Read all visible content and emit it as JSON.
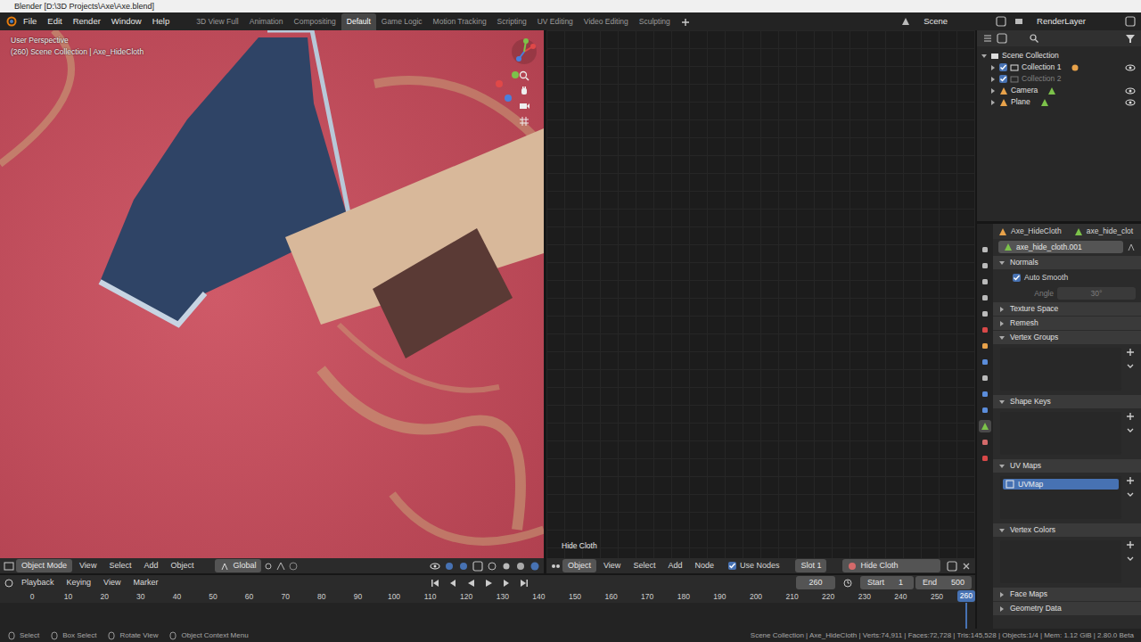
{
  "window": {
    "title": "Blender [D:\\3D Projects\\Axe\\Axe.blend]"
  },
  "menu": [
    "File",
    "Edit",
    "Render",
    "Window",
    "Help"
  ],
  "workspaces": [
    {
      "label": "3D View Full",
      "selected": false
    },
    {
      "label": "Animation",
      "selected": false
    },
    {
      "label": "Compositing",
      "selected": false
    },
    {
      "label": "Default",
      "selected": true
    },
    {
      "label": "Game Logic",
      "selected": false
    },
    {
      "label": "Motion Tracking",
      "selected": false
    },
    {
      "label": "Scripting",
      "selected": false
    },
    {
      "label": "UV Editing",
      "selected": false
    },
    {
      "label": "Video Editing",
      "selected": false
    },
    {
      "label": "Sculpting",
      "selected": false
    }
  ],
  "scene": "Scene",
  "render_layer": "RenderLayer",
  "viewport": {
    "overlay_title": "User Perspective",
    "overlay_info": "(260) Scene Collection | Axe_HideCloth",
    "mode": "Object Mode",
    "menus": [
      "View",
      "Select",
      "Add",
      "Object"
    ],
    "orientation": "Global"
  },
  "node_editor": {
    "node_label": "Hide Cloth",
    "mode": "Object",
    "menus": [
      "View",
      "Select",
      "Add",
      "Node"
    ],
    "use_nodes": {
      "label": "Use Nodes",
      "checked": true
    },
    "slot": "Slot 1",
    "material": "Hide Cloth"
  },
  "timeline": {
    "menus": [
      "Playback",
      "Keying",
      "View",
      "Marker"
    ],
    "current_frame": "260",
    "start_label": "Start",
    "start": "1",
    "end_label": "End",
    "end": "500",
    "ticks": [
      "0",
      "10",
      "20",
      "30",
      "40",
      "50",
      "60",
      "70",
      "80",
      "90",
      "100",
      "110",
      "120",
      "130",
      "140",
      "150",
      "160",
      "170",
      "180",
      "190",
      "200",
      "210",
      "220",
      "230",
      "240",
      "250"
    ],
    "playhead": "260"
  },
  "outliner": {
    "items": [
      {
        "label": "Scene Collection",
        "kind": "scene",
        "expanded": true,
        "disabled": false,
        "visible": false
      },
      {
        "label": "Collection 1",
        "kind": "collection",
        "expanded": false,
        "checked": true,
        "disabled": false,
        "visible": true
      },
      {
        "label": "Collection 2",
        "kind": "collection",
        "expanded": false,
        "checked": true,
        "disabled": true,
        "visible": false
      },
      {
        "label": "Camera",
        "kind": "object",
        "expanded": false,
        "disabled": false,
        "visible": true
      },
      {
        "label": "Plane",
        "kind": "object",
        "expanded": false,
        "disabled": false,
        "visible": true
      }
    ]
  },
  "property_tabs": [
    {
      "selected": false
    },
    {
      "selected": false
    },
    {
      "selected": false
    },
    {
      "selected": false
    },
    {
      "selected": false
    },
    {
      "selected": false
    },
    {
      "selected": false
    },
    {
      "selected": false
    },
    {
      "selected": false
    },
    {
      "selected": false
    },
    {
      "selected": false
    },
    {
      "selected": true
    },
    {
      "selected": false
    },
    {
      "selected": false
    }
  ],
  "properties": {
    "object": "Axe_HideCloth",
    "mesh_tab": "axe_hide_clot",
    "datablock": "axe_hide_cloth.001",
    "panels": [
      {
        "title": "Normals",
        "kind": "normals",
        "expanded": true,
        "auto_smooth": {
          "label": "Auto Smooth",
          "checked": true
        },
        "angle": {
          "label": "Angle",
          "value": "30°",
          "disabled": true
        }
      },
      {
        "title": "Texture Space",
        "kind": "plain",
        "expanded": false
      },
      {
        "title": "Remesh",
        "kind": "plain",
        "expanded": false
      },
      {
        "title": "Vertex Groups",
        "kind": "list",
        "expanded": true,
        "items": []
      },
      {
        "title": "Shape Keys",
        "kind": "list",
        "expanded": true,
        "items": []
      },
      {
        "title": "UV Maps",
        "kind": "list",
        "expanded": true,
        "items": [
          {
            "label": "UVMap",
            "selected": true
          }
        ]
      },
      {
        "title": "Vertex Colors",
        "kind": "list",
        "expanded": true,
        "items": []
      },
      {
        "title": "Face Maps",
        "kind": "plain",
        "expanded": false
      },
      {
        "title": "Geometry Data",
        "kind": "plain",
        "expanded": false
      }
    ]
  },
  "status_bar": {
    "left": [
      "Select",
      "Box Select",
      "Rotate View",
      "Object Context Menu"
    ],
    "right": "Scene Collection | Axe_HideCloth | Verts:74,911 | Faces:72,728 | Tris:145,528 | Objects:1/4 | Mem: 1.12 GiB | 2.80.0 Beta"
  }
}
